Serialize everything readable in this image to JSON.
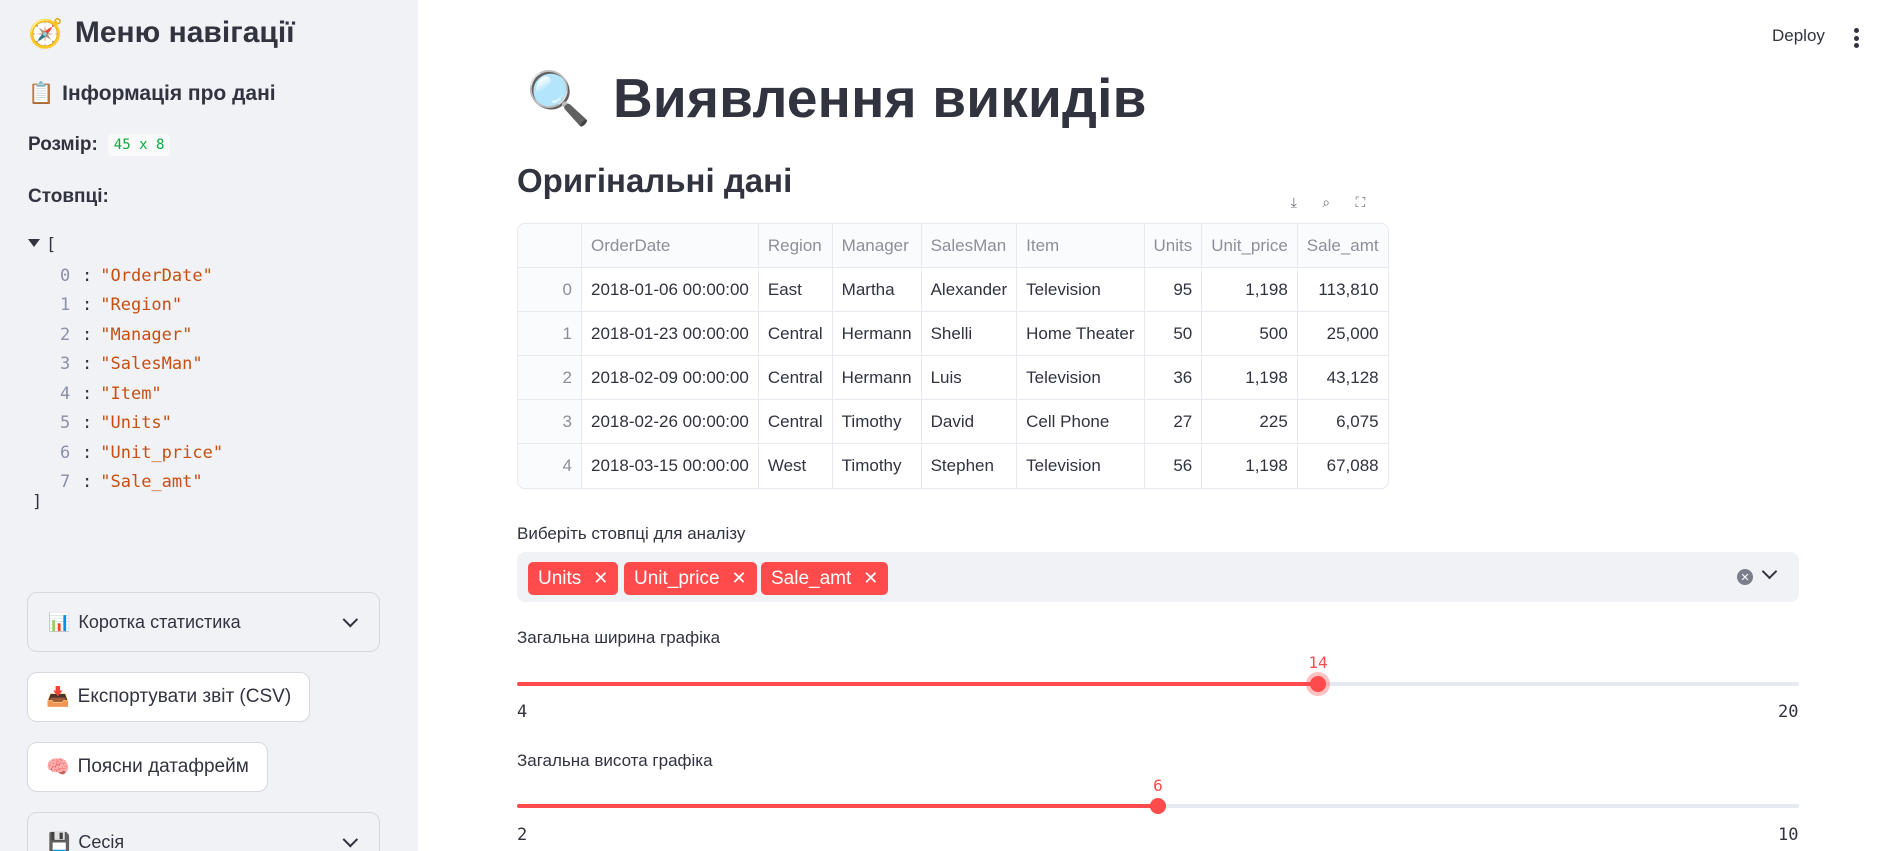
{
  "sidebar": {
    "title_icon": "🧭",
    "title": "Меню навігації",
    "info_icon": "📋",
    "info_title": "Інформація про дані",
    "size_label": "Розмір:",
    "size_value": "45 x 8",
    "columns_label": "Стовпці:",
    "json_open": "[",
    "json_close": "]",
    "columns": [
      {
        "index": "0",
        "name": "\"OrderDate\""
      },
      {
        "index": "1",
        "name": "\"Region\""
      },
      {
        "index": "2",
        "name": "\"Manager\""
      },
      {
        "index": "3",
        "name": "\"SalesMan\""
      },
      {
        "index": "4",
        "name": "\"Item\""
      },
      {
        "index": "5",
        "name": "\"Units\""
      },
      {
        "index": "6",
        "name": "\"Unit_price\""
      },
      {
        "index": "7",
        "name": "\"Sale_amt\""
      }
    ],
    "stats_icon": "📊",
    "stats_label": "Коротка статистика",
    "export_icon": "📥",
    "export_label": "Експортувати звіт (CSV)",
    "explain_icon": "🧠",
    "explain_label": "Поясни датафрейм",
    "session_icon": "💾",
    "session_label": "Сесія"
  },
  "header": {
    "deploy_label": "Deploy"
  },
  "main": {
    "title_icon": "🔍",
    "title": "Виявлення викидів",
    "section_title": "Оригінальні дані",
    "table": {
      "headers": [
        "",
        "OrderDate",
        "Region",
        "Manager",
        "SalesMan",
        "Item",
        "Units",
        "Unit_price",
        "Sale_amt"
      ],
      "rows": [
        [
          "0",
          "2018-01-06 00:00:00",
          "East",
          "Martha",
          "Alexander",
          "Television",
          "95",
          "1,198",
          "113,810"
        ],
        [
          "1",
          "2018-01-23 00:00:00",
          "Central",
          "Hermann",
          "Shelli",
          "Home Theater",
          "50",
          "500",
          "25,000"
        ],
        [
          "2",
          "2018-02-09 00:00:00",
          "Central",
          "Hermann",
          "Luis",
          "Television",
          "36",
          "1,198",
          "43,128"
        ],
        [
          "3",
          "2018-02-26 00:00:00",
          "Central",
          "Timothy",
          "David",
          "Cell Phone",
          "27",
          "225",
          "6,075"
        ],
        [
          "4",
          "2018-03-15 00:00:00",
          "West",
          "Timothy",
          "Stephen",
          "Television",
          "56",
          "1,198",
          "67,088"
        ]
      ]
    },
    "multiselect": {
      "label": "Виберіть стовпці для аналізу",
      "selected": [
        "Units",
        "Unit_price",
        "Sale_amt"
      ]
    },
    "width_slider": {
      "label": "Загальна ширина графіка",
      "min": "4",
      "max": "20",
      "value": "14"
    },
    "height_slider": {
      "label": "Загальна висота графіка",
      "min": "2",
      "max": "10",
      "value": "6"
    }
  },
  "colors": {
    "accent": "#ff4b4b",
    "sidebar_bg": "#f0f2f6",
    "code_green": "#09ab3b",
    "json_string": "#c74f12"
  }
}
